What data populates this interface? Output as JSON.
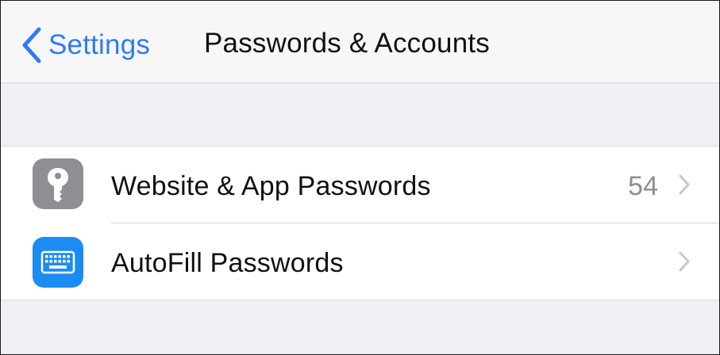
{
  "navbar": {
    "back_label": "Settings",
    "title": "Passwords & Accounts"
  },
  "rows": [
    {
      "label": "Website & App Passwords",
      "value": "54",
      "icon": "key-icon",
      "icon_color": "#8e8e93"
    },
    {
      "label": "AutoFill Passwords",
      "value": "",
      "icon": "keyboard-icon",
      "icon_color": "#1b8cf3"
    }
  ],
  "colors": {
    "accent": "#2f7bf5",
    "background": "#efeff4",
    "secondary_text": "#8e8e93"
  }
}
